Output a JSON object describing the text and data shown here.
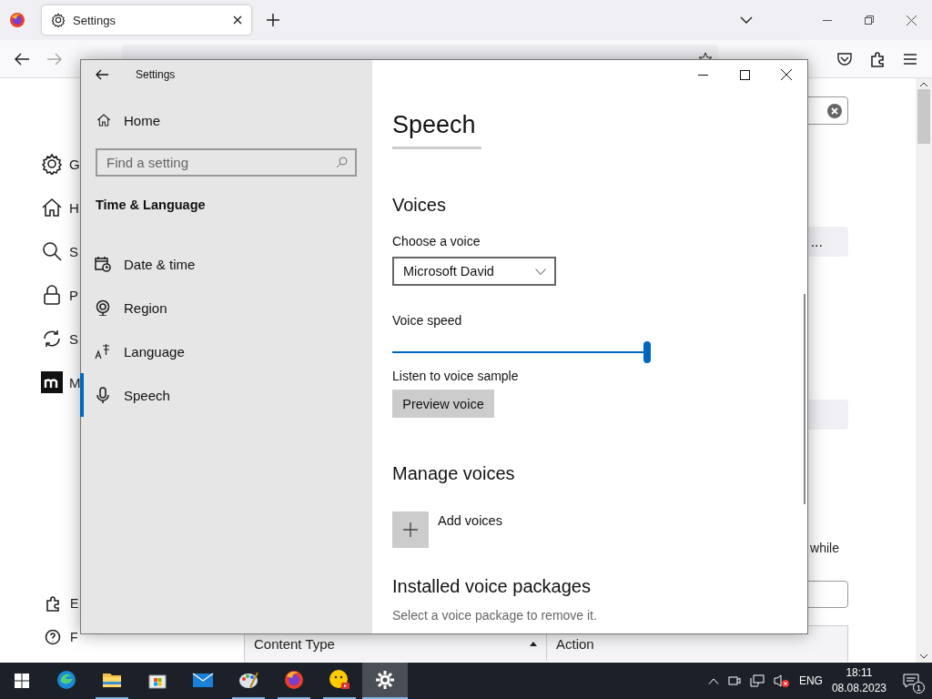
{
  "browser": {
    "tab": {
      "title": "Settings"
    },
    "page": {
      "sidebar": [
        {
          "text": "G"
        },
        {
          "text": "H"
        },
        {
          "text": "S"
        },
        {
          "text": "P"
        },
        {
          "text": "S"
        },
        {
          "text": "M"
        }
      ],
      "footer_links": [
        {
          "text": "E"
        },
        {
          "text": "F"
        }
      ],
      "button_1": "...",
      "text_1": "while",
      "table": {
        "columns": [
          {
            "label": "Content Type",
            "sorted": true
          },
          {
            "label": "Action",
            "sorted": false
          }
        ]
      }
    }
  },
  "settings": {
    "title": "Settings",
    "nav": {
      "home": "Home",
      "search_placeholder": "Find a setting",
      "section": "Time & Language",
      "items": [
        {
          "kind": "datetime",
          "label": "Date & time",
          "selected": false
        },
        {
          "kind": "region",
          "label": "Region",
          "selected": false
        },
        {
          "kind": "language",
          "label": "Language",
          "selected": false
        },
        {
          "kind": "speech",
          "label": "Speech",
          "selected": true
        }
      ]
    },
    "content": {
      "title": "Speech",
      "voices": {
        "heading": "Voices",
        "choose_label": "Choose a voice",
        "voice": "Microsoft David",
        "speed_label": "Voice speed",
        "speed": {
          "level": 1.0
        },
        "sample_label": "Listen to voice sample",
        "preview_button": "Preview voice"
      },
      "manage": {
        "heading": "Manage voices",
        "add": "Add voices"
      },
      "installed": {
        "heading": "Installed voice packages",
        "hint": "Select a voice package to remove it."
      }
    }
  },
  "taskbar": {
    "apps": [
      {
        "kind": "edge",
        "running": false,
        "selected": false
      },
      {
        "kind": "folder",
        "running": true,
        "selected": false
      },
      {
        "kind": "store",
        "running": false,
        "selected": false
      },
      {
        "kind": "mail",
        "running": false,
        "selected": false
      },
      {
        "kind": "paint",
        "running": true,
        "selected": false
      },
      {
        "kind": "firefox",
        "running": true,
        "selected": false
      },
      {
        "kind": "emoji",
        "running": true,
        "selected": false
      },
      {
        "kind": "settings",
        "running": true,
        "selected": true
      }
    ],
    "tray": {
      "language": "ENG",
      "time": "18:11",
      "date": "08.08.2023",
      "notifications": "1"
    }
  }
}
